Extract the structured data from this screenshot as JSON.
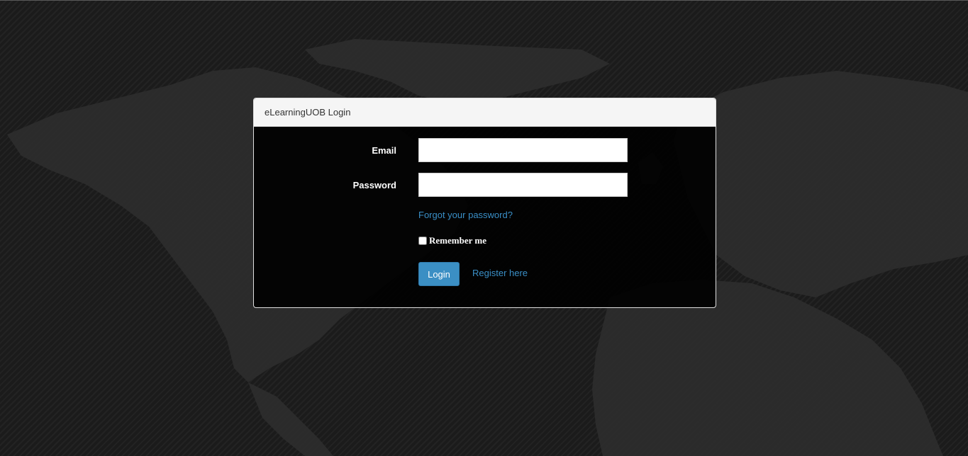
{
  "panel": {
    "title": "eLearningUOB Login"
  },
  "form": {
    "email_label": "Email",
    "email_value": "",
    "password_label": "Password",
    "password_value": "",
    "forgot_link": "Forgot your password?",
    "remember_label": "Remember me",
    "remember_checked": false,
    "login_button": "Login",
    "register_link": "Register here"
  },
  "colors": {
    "background": "#1b1b1b",
    "accent": "#3b8fc4",
    "link": "#3a8fc7",
    "panel_heading": "#f5f5f5"
  }
}
